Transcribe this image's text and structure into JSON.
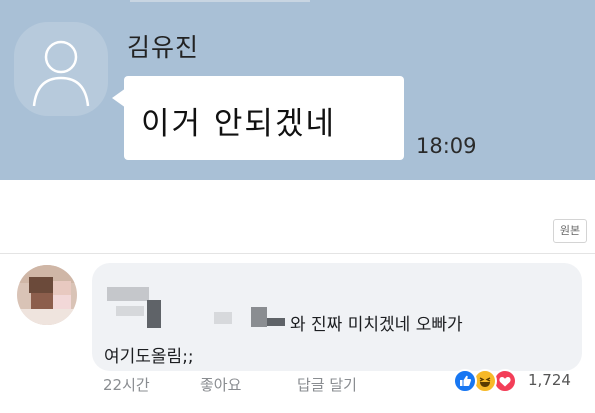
{
  "chat": {
    "sender_name": "김유진",
    "message": "이거 안되겠네",
    "time": "18:09"
  },
  "original_label": "원본",
  "comment": {
    "text_line1": "와 진짜 미치겠네 오빠가",
    "text_line2": "여기도올림;;",
    "time_ago": "22시간",
    "like_label": "좋아요",
    "reply_label": "답글 달기",
    "reactions": [
      "like-icon",
      "haha-icon",
      "love-icon"
    ],
    "reaction_count": "1,724"
  },
  "colors": {
    "chat_background": "#a9c0d6",
    "comment_bubble": "#f0f2f5",
    "like_blue": "#1877f2",
    "haha_yellow": "#f7b928",
    "love_red": "#f33e58"
  }
}
